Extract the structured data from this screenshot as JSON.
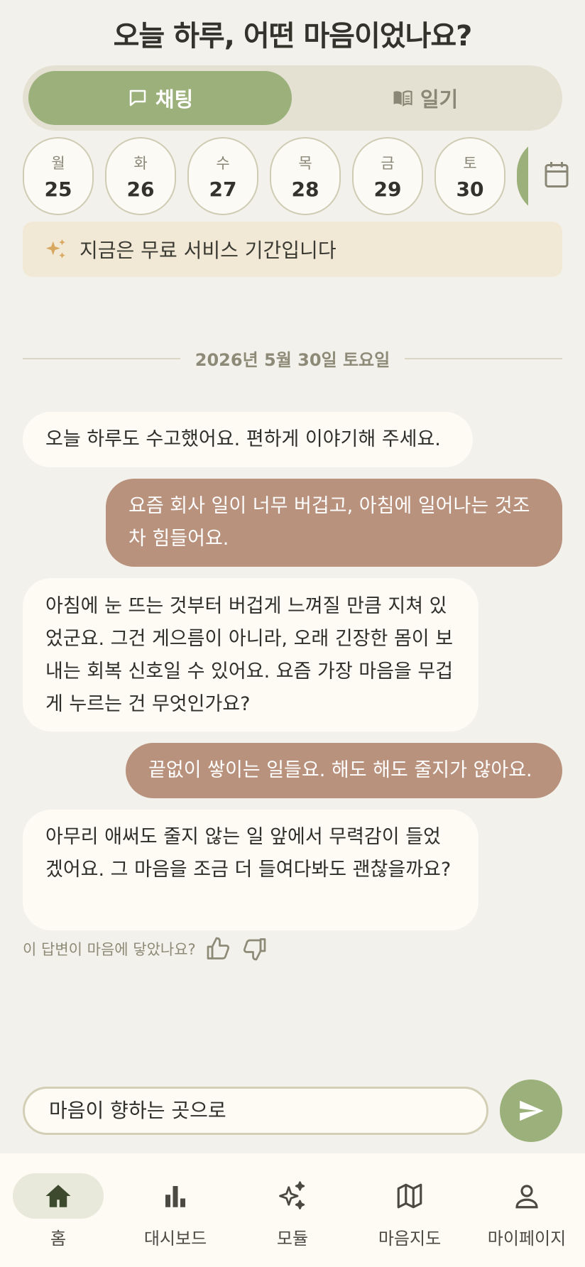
{
  "header": {
    "title": "오늘 하루, 어떤 마음이었나요?"
  },
  "tabs": [
    {
      "label": "채팅",
      "icon": "chat-bubble-icon",
      "active": true
    },
    {
      "label": "일기",
      "icon": "book-icon",
      "active": false
    }
  ],
  "days": [
    {
      "weekday": "월",
      "date": "25"
    },
    {
      "weekday": "화",
      "date": "26"
    },
    {
      "weekday": "수",
      "date": "27"
    },
    {
      "weekday": "목",
      "date": "28"
    },
    {
      "weekday": "금",
      "date": "29"
    },
    {
      "weekday": "토",
      "date": "30"
    }
  ],
  "notice": {
    "text": "지금은 무료 서비스 기간입니다",
    "icon": "sparkle-icon"
  },
  "chat": {
    "date_label": "2026년 5월 30일 토요일",
    "messages": [
      {
        "role": "bot",
        "text": "오늘 하루도 수고했어요. 편하게 이야기해 주세요."
      },
      {
        "role": "user",
        "text": "요즘 회사 일이 너무 버겁고, 아침에 일어나는 것조차 힘들어요."
      },
      {
        "role": "bot",
        "text": "아침에 눈 뜨는 것부터 버겁게 느껴질 만큼 지쳐 있었군요. 그건 게으름이 아니라, 오래 긴장한 몸이 보내는 회복 신호일 수 있어요. 요즘 가장 마음을 무겁게 누르는 건 무엇인가요?"
      },
      {
        "role": "user",
        "text": "끝없이 쌓이는 일들요. 해도 해도 줄지가 않아요."
      },
      {
        "role": "bot",
        "text": "아무리 애써도 줄지 않는 일 앞에서 무력감이 들었겠어요. 그 마음을 조금 더 들여다봐도 괜찮을까요?"
      }
    ],
    "feedback_prompt": "이 답변이 마음에 닿았나요?"
  },
  "composer": {
    "value": "마음이 향하는 곳으로",
    "send_icon": "send-icon"
  },
  "bottom_nav": [
    {
      "label": "홈",
      "icon": "home-icon",
      "active": true
    },
    {
      "label": "대시보드",
      "icon": "bar-chart-icon",
      "active": false
    },
    {
      "label": "모듈",
      "icon": "sparkle-icon",
      "active": false
    },
    {
      "label": "마음지도",
      "icon": "map-icon",
      "active": false
    },
    {
      "label": "마이페이지",
      "icon": "person-icon",
      "active": false
    }
  ],
  "colors": {
    "background": "#f3f1eb",
    "accent_green": "#9bb07b",
    "user_bubble": "#b8927d",
    "bot_bubble": "#fdfbf4",
    "notice_bg": "#f1e9d6"
  }
}
